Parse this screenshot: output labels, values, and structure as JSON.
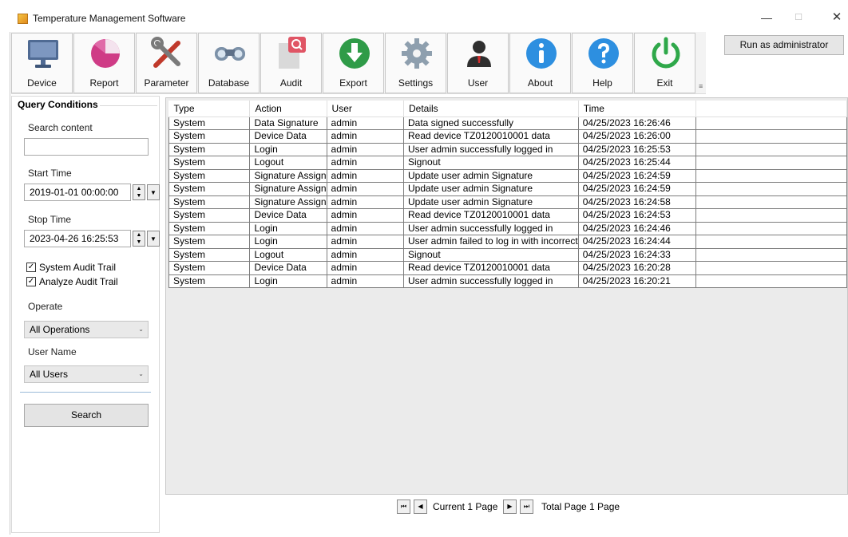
{
  "window": {
    "title": "Temperature Management Software",
    "minimize": "—",
    "maximize": "☐",
    "close": "✕"
  },
  "toolbar": {
    "items": [
      {
        "label": "Device",
        "icon": "monitor-icon"
      },
      {
        "label": "Report",
        "icon": "pie-chart-icon"
      },
      {
        "label": "Parameter",
        "icon": "tools-icon"
      },
      {
        "label": "Database",
        "icon": "binoculars-icon"
      },
      {
        "label": "Audit",
        "icon": "audit-search-icon"
      },
      {
        "label": "Export",
        "icon": "download-icon"
      },
      {
        "label": "Settings",
        "icon": "gear-icon"
      },
      {
        "label": "User",
        "icon": "user-icon"
      },
      {
        "label": "About",
        "icon": "info-icon"
      },
      {
        "label": "Help",
        "icon": "help-icon"
      },
      {
        "label": "Exit",
        "icon": "power-icon"
      }
    ]
  },
  "run_admin_label": "Run as administrator",
  "query": {
    "title": "Query Conditions",
    "search_content_label": "Search content",
    "search_content_value": "",
    "start_time_label": "Start Time",
    "start_time_value": "2019-01-01 00:00:00",
    "stop_time_label": "Stop Time",
    "stop_time_value": "2023-04-26 16:25:53",
    "system_audit_label": "System Audit Trail",
    "system_audit_checked": true,
    "analyze_audit_label": "Analyze Audit Trail",
    "analyze_audit_checked": true,
    "operate_label": "Operate",
    "operate_value": "All Operations",
    "user_name_label": "User Name",
    "user_name_value": "All Users",
    "search_button": "Search"
  },
  "table": {
    "columns": [
      "Type",
      "Action",
      "User",
      "Details",
      "Time"
    ],
    "rows": [
      [
        "System",
        "Data Signature",
        "admin",
        "Data signed successfully",
        "04/25/2023 16:26:46"
      ],
      [
        "System",
        "Device Data",
        "admin",
        "Read device TZ0120010001 data",
        "04/25/2023 16:26:00"
      ],
      [
        "System",
        "Login",
        "admin",
        "User admin successfully logged in",
        "04/25/2023 16:25:53"
      ],
      [
        "System",
        "Logout",
        "admin",
        "Signout",
        "04/25/2023 16:25:44"
      ],
      [
        "System",
        "Signature Assign",
        "admin",
        "Update user admin Signature",
        "04/25/2023 16:24:59"
      ],
      [
        "System",
        "Signature Assign",
        "admin",
        "Update user admin Signature",
        "04/25/2023 16:24:59"
      ],
      [
        "System",
        "Signature Assign",
        "admin",
        "Update user admin Signature",
        "04/25/2023 16:24:58"
      ],
      [
        "System",
        "Device Data",
        "admin",
        "Read device TZ0120010001 data",
        "04/25/2023 16:24:53"
      ],
      [
        "System",
        "Login",
        "admin",
        "User admin successfully logged in",
        "04/25/2023 16:24:46"
      ],
      [
        "System",
        "Login",
        "admin",
        "User admin failed to log in with incorrect",
        "04/25/2023 16:24:44"
      ],
      [
        "System",
        "Logout",
        "admin",
        "Signout",
        "04/25/2023 16:24:33"
      ],
      [
        "System",
        "Device Data",
        "admin",
        "Read device TZ0120010001 data",
        "04/25/2023 16:20:28"
      ],
      [
        "System",
        "Login",
        "admin",
        "User admin successfully logged in",
        "04/25/2023 16:20:21"
      ]
    ]
  },
  "pager": {
    "current": "Current 1 Page",
    "total": "Total Page 1 Page"
  }
}
